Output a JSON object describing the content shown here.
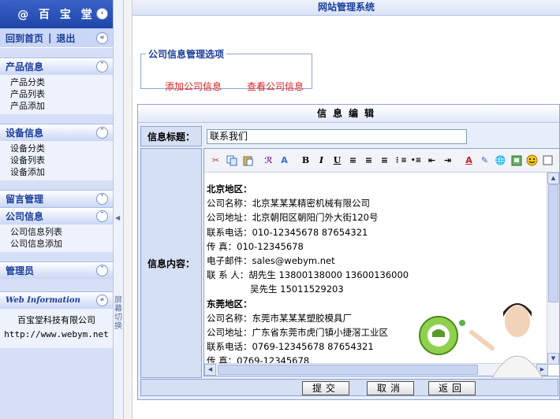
{
  "sidebar": {
    "logo": "@ 百 宝 堂",
    "links": {
      "home": "回到首页",
      "separator": "|",
      "logout": "退出"
    },
    "menus": [
      {
        "title": "产品信息",
        "items": [
          "产品分类",
          "产品列表",
          "产品添加"
        ]
      },
      {
        "title": "设备信息",
        "items": [
          "设备分类",
          "设备列表",
          "设备添加"
        ]
      },
      {
        "title": "留言管理",
        "items": []
      },
      {
        "title": "公司信息",
        "items": [
          "公司信息列表",
          "公司信息添加"
        ]
      },
      {
        "title": "管理员",
        "items": []
      }
    ],
    "web_info": {
      "title": "Web Information",
      "company": "百宝堂科技有限公司",
      "url": "http://www.webym.net"
    }
  },
  "splitter": {
    "label": "屏幕切换"
  },
  "header": {
    "title": "网站管理系统"
  },
  "options": {
    "legend": "公司信息管理选项",
    "add": "添加公司信息",
    "view": "查看公司信息"
  },
  "form": {
    "heading": "信息编辑",
    "title_label": "信息标题：",
    "title_value": "联系我们",
    "content_label": "信息内容：",
    "content_lines": [
      "北京地区：",
      "公司名称：北京某某某精密机械有限公司",
      "公司地址：北京朝阳区朝阳门外大街120号",
      "联系电话：010-12345678 87654321",
      "传 真：010-12345678",
      "电子邮件：sales@webym.net",
      "联 系 人：胡先生 13800138000 13600136000",
      "吴先生 15011529203",
      "东莞地区：",
      "公司名称：东莞市某某某塑胶模具厂",
      "公司地址：广东省东莞市虎门镇小捷滘工业区",
      "联系电话：0769-12345678 87654321",
      "传 真：0769-12345678"
    ],
    "buttons": {
      "submit": "提交",
      "cancel": "取消",
      "back": "返回"
    }
  },
  "toolbar_icons": [
    "cut-icon",
    "copy-icon",
    "paste-icon",
    "font-style-icon",
    "font-size-icon",
    "bold-icon",
    "italic-icon",
    "underline-icon",
    "align-left-icon",
    "align-center-icon",
    "align-right-icon",
    "ordered-list-icon",
    "unordered-list-icon",
    "outdent-icon",
    "indent-icon",
    "font-color-icon",
    "highlight-icon",
    "link-icon",
    "image-icon",
    "emoticon-icon",
    "more-icon"
  ],
  "colors": {
    "accent": "#1b3e9c",
    "option_link": "#e02020",
    "sidebar_bg": "#d6dff7"
  }
}
